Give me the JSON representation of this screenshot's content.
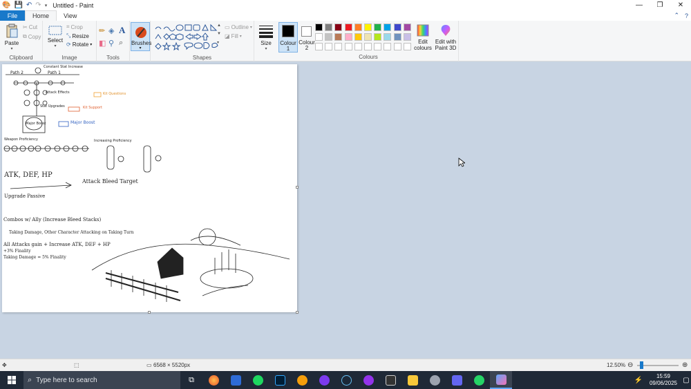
{
  "window": {
    "title": "Untitled - Paint",
    "controls": {
      "minimize": "—",
      "maximize": "❐",
      "close": "✕"
    }
  },
  "tabs": {
    "file": "File",
    "home": "Home",
    "view": "View"
  },
  "ribbon": {
    "clipboard": {
      "label": "Clipboard",
      "paste": "Paste",
      "cut": "Cut",
      "copy": "Copy"
    },
    "image": {
      "label": "Image",
      "select": "Select",
      "crop": "Crop",
      "resize": "Resize",
      "rotate": "Rotate"
    },
    "tools": {
      "label": "Tools"
    },
    "brushes": {
      "label": "Brushes"
    },
    "shapes": {
      "label": "Shapes",
      "outline": "Outline",
      "fill": "Fill"
    },
    "size": {
      "label": "Size"
    },
    "colour1": {
      "label": "Colour",
      "num": "1"
    },
    "colour2": {
      "label": "Colour",
      "num": "2"
    },
    "colours": {
      "label": "Colours",
      "row1": [
        "#000000",
        "#7f7f7f",
        "#880015",
        "#ed1c24",
        "#ff7f27",
        "#fff200",
        "#22b14c",
        "#00a2e8",
        "#3f48cc",
        "#a349a4"
      ],
      "row2": [
        "#ffffff",
        "#c3c3c3",
        "#b97a57",
        "#ffaec9",
        "#ffc90e",
        "#efe4b0",
        "#b5e61d",
        "#99d9ea",
        "#7092be",
        "#c8bfe7"
      ],
      "row3": [
        "#ffffff",
        "#ffffff",
        "#ffffff",
        "#ffffff",
        "#ffffff",
        "#ffffff",
        "#ffffff",
        "#ffffff",
        "#ffffff",
        "#ffffff"
      ],
      "edit_colours_line1": "Edit",
      "edit_colours_line2": "colours",
      "paint3d_line1": "Edit with",
      "paint3d_line2": "Paint 3D"
    }
  },
  "canvas_text": {
    "path2": "Path 2",
    "path1": "Path 1",
    "crit_dmg": "Constant Stat Increase",
    "attack_effects": "Attack Effects",
    "skill_upgrades": "Stat Upgrades",
    "major_boost": "Major Boost",
    "kit_questions": "Kit Questions",
    "kit_support": "Kit Support",
    "major_boost2": "Major Boost",
    "weapon_proficiency": "Weapon Proficiency",
    "increasing_proficiency": "Increasing Proficiency",
    "atk_line": "ATK, DEF, HP",
    "attack_bleed_target": "Attack Bleed Target",
    "upgrade_passive": "Upgrade Passive",
    "combos_ally": "Combos w/ Ally (Increase Bleed Stacks)",
    "other_character": "Taking Damage, Other Character Attacking on Taking Turn",
    "all_attacks": "All Attacks gain + Increase ATK, DEF + HP",
    "finality": "+3% Finality",
    "taking_damage": "Taking Damage = 5% Finality"
  },
  "statusbar": {
    "dimensions": "6568 × 5520px",
    "zoom": "12.50%"
  },
  "taskbar": {
    "search_placeholder": "Type here to search",
    "time": "15:59",
    "date": "09/06/2025"
  }
}
